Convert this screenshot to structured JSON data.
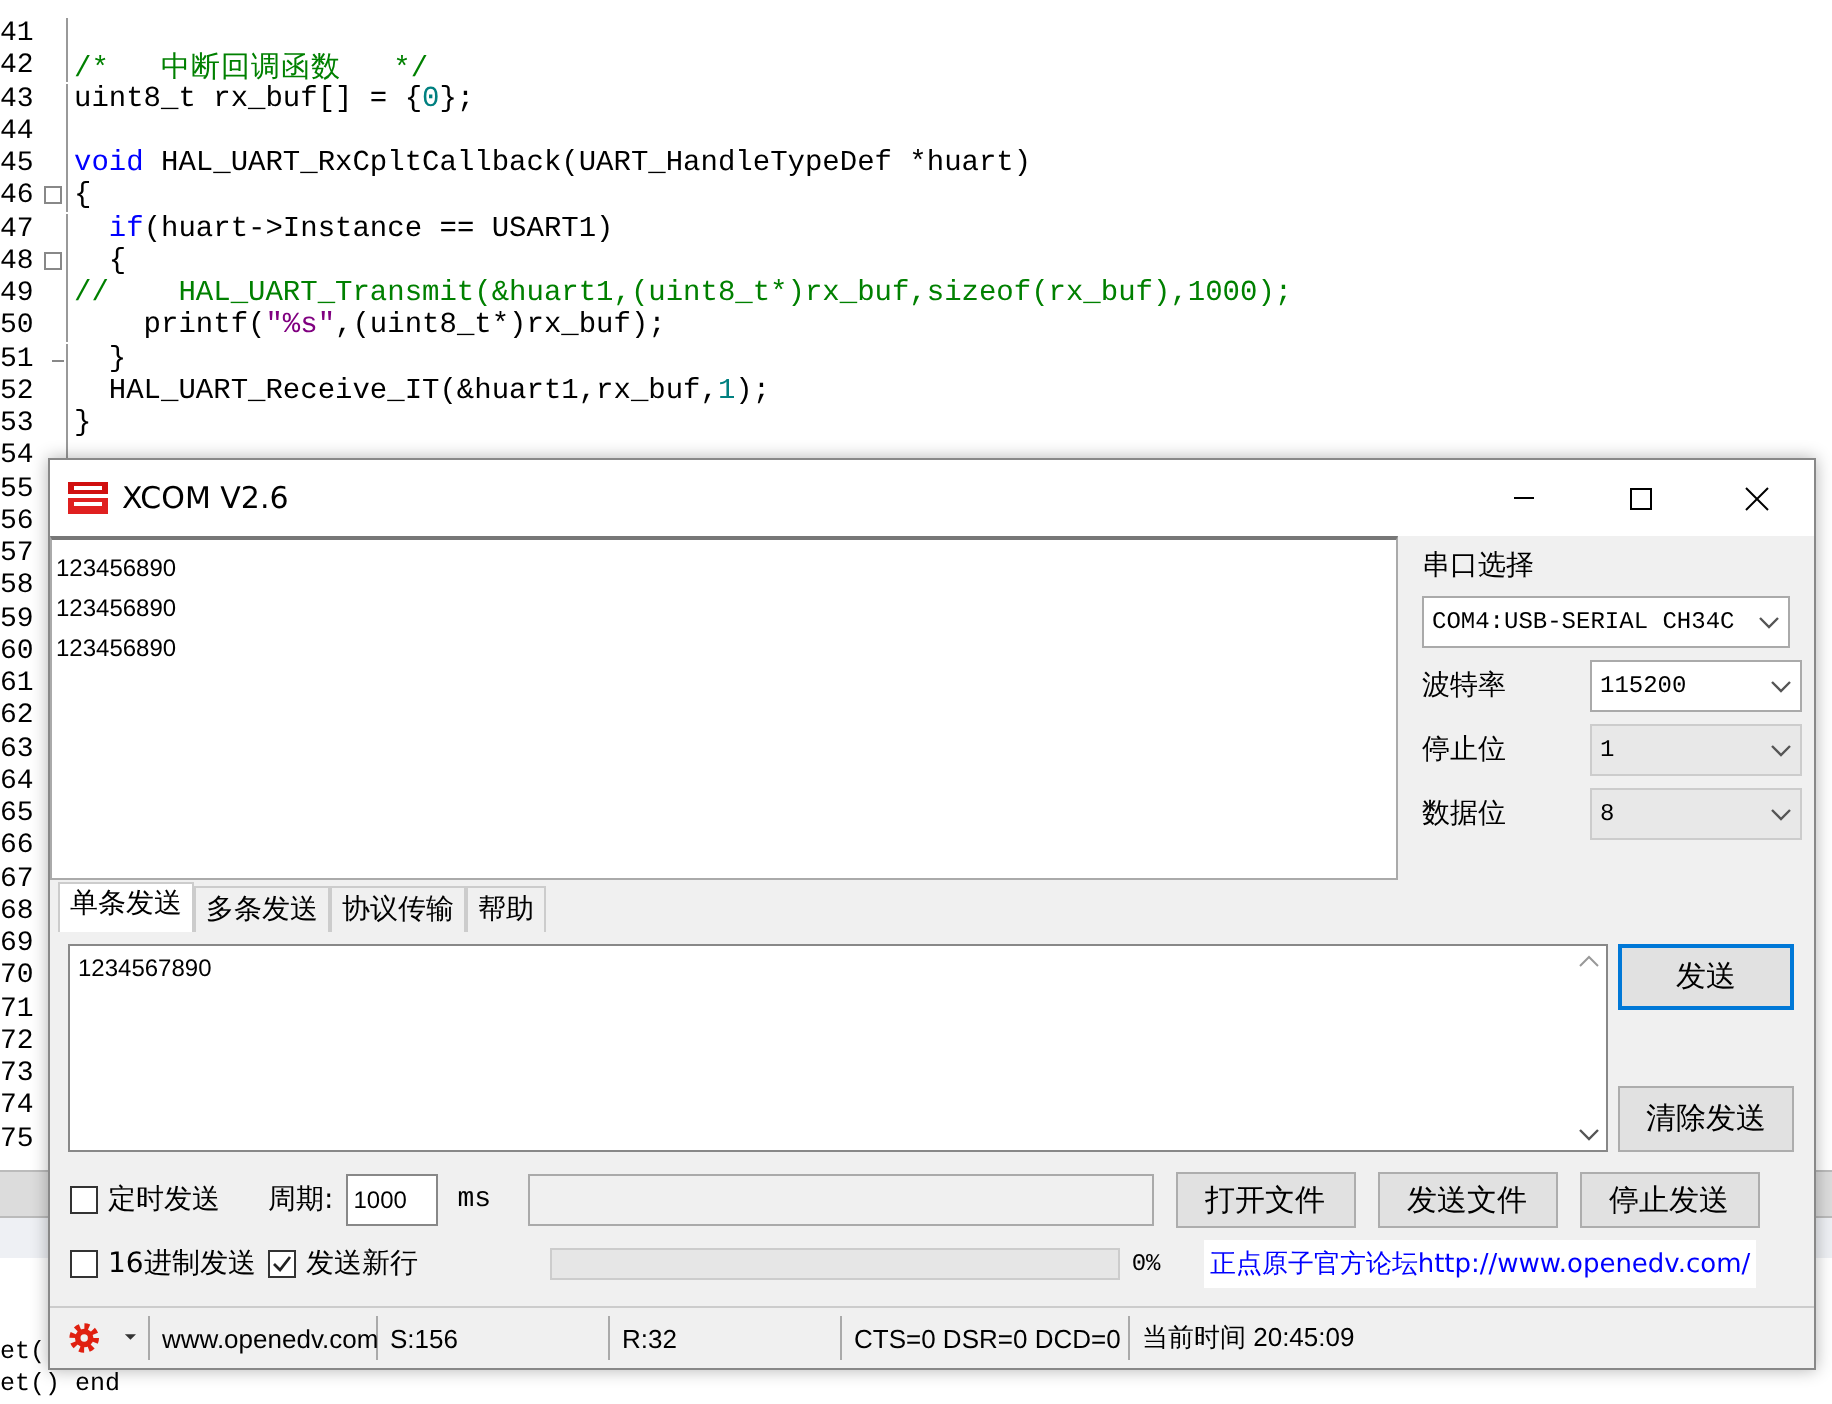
{
  "editor": {
    "lines": [
      {
        "number": "41"
      },
      {
        "number": "42",
        "segments": [
          {
            "text": "/*   中断回调函数   */",
            "kind": "comment"
          }
        ]
      },
      {
        "number": "43",
        "segments": [
          {
            "text": "uint8_t rx_buf[] = {",
            "kind": "plain"
          },
          {
            "text": "0",
            "kind": "number"
          },
          {
            "text": "};",
            "kind": "plain"
          }
        ]
      },
      {
        "number": "44"
      },
      {
        "number": "45",
        "segments": [
          {
            "text": "void",
            "kind": "keyword"
          },
          {
            "text": " HAL_UART_RxCpltCallback(UART_HandleTypeDef *huart)",
            "kind": "plain"
          }
        ]
      },
      {
        "number": "46",
        "fold_open": true,
        "segments": [
          {
            "text": "{",
            "kind": "plain"
          }
        ]
      },
      {
        "number": "47",
        "segments": [
          {
            "text": "  if",
            "kind": "keyword"
          },
          {
            "text": "(huart->Instance == USART1)",
            "kind": "plain"
          }
        ]
      },
      {
        "number": "48",
        "fold_open": true,
        "segments": [
          {
            "text": "  {",
            "kind": "plain"
          }
        ]
      },
      {
        "number": "49",
        "segments": [
          {
            "text": "//    HAL_UART_Transmit(&huart1,(uint8_t*)rx_buf,sizeof(rx_buf),1000);",
            "kind": "comment"
          }
        ]
      },
      {
        "number": "50",
        "segments": [
          {
            "text": "    printf(",
            "kind": "plain"
          },
          {
            "text": "\"%s\"",
            "kind": "string"
          },
          {
            "text": ",(uint8_t*)rx_buf);",
            "kind": "plain"
          }
        ]
      },
      {
        "number": "51",
        "fold_close": true,
        "segments": [
          {
            "text": "  }",
            "kind": "plain"
          }
        ]
      },
      {
        "number": "52",
        "segments": [
          {
            "text": "  HAL_UART_Receive_IT(&huart1,rx_buf,",
            "kind": "plain"
          },
          {
            "text": "1",
            "kind": "number"
          },
          {
            "text": ");",
            "kind": "plain"
          }
        ]
      },
      {
        "number": "53",
        "segments": [
          {
            "text": "}",
            "kind": "plain"
          }
        ]
      },
      {
        "number": "54"
      },
      {
        "number": "55"
      },
      {
        "number": "56"
      },
      {
        "number": "57"
      },
      {
        "number": "58"
      },
      {
        "number": "59"
      },
      {
        "number": "60"
      },
      {
        "number": "61"
      },
      {
        "number": "62"
      },
      {
        "number": "63"
      },
      {
        "number": "64"
      },
      {
        "number": "65"
      },
      {
        "number": "66"
      },
      {
        "number": "67"
      },
      {
        "number": "68"
      },
      {
        "number": "69"
      },
      {
        "number": "70"
      },
      {
        "number": "71"
      },
      {
        "number": "72"
      },
      {
        "number": "73"
      },
      {
        "number": "74"
      },
      {
        "number": "75"
      }
    ]
  },
  "output_panel": {
    "lines": [
      "et(",
      "et() end"
    ]
  },
  "xcom": {
    "title": "XCOM V2.6",
    "received_lines": [
      "123456890",
      "123456890",
      "123456890"
    ],
    "settings": [
      {
        "label": "串口选择",
        "value": "COM4:USB-SERIAL CH34C",
        "kind": "wide",
        "enabled": true
      },
      {
        "label": "波特率",
        "value": "115200",
        "kind": "inline",
        "enabled": true
      },
      {
        "label": "停止位",
        "value": "1",
        "kind": "inline",
        "enabled": false
      },
      {
        "label": "数据位",
        "value": "8",
        "kind": "inline",
        "enabled": false
      }
    ],
    "tabs": [
      {
        "label": "单条发送",
        "selected": true
      },
      {
        "label": "多条发送",
        "selected": false
      },
      {
        "label": "协议传输",
        "selected": false
      },
      {
        "label": "帮助",
        "selected": false
      }
    ],
    "send_text": "1234567890",
    "send_button": "发送",
    "clear_button": "清除发送",
    "timed_send": {
      "label": "定时发送",
      "checked": false
    },
    "period_label": "周期:",
    "period_value": "1000",
    "period_unit": "ms",
    "file_buttons": [
      "打开文件",
      "发送文件",
      "停止发送"
    ],
    "hex_send": {
      "label": "16进制发送",
      "checked": false
    },
    "newline_send": {
      "label": "发送新行",
      "checked": true
    },
    "progress": {
      "level": 0,
      "reading": "0%"
    },
    "forum_link": "正点原子官方论坛http://www.openedv.com/",
    "status_bar": [
      "www.openedv.com",
      "S:156",
      "R:32",
      "CTS=0 DSR=0 DCD=0",
      "当前时间 20:45:09"
    ]
  }
}
